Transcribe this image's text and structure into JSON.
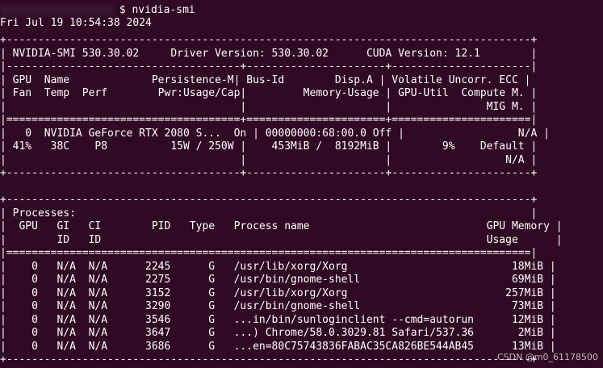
{
  "command": {
    "prompt_symbol": "$",
    "text": "nvidia-smi"
  },
  "timestamp": "Fri Jul 19 10:54:38 2024",
  "header": {
    "smi_label": "NVIDIA-SMI 530.30.02",
    "driver_label": "Driver Version: 530.30.02",
    "cuda_label": "CUDA Version: 12.1"
  },
  "gpu_columns": {
    "line1": "| GPU  Name             Persistence-M| Bus-Id        Disp.A | Volatile Uncorr. ECC |",
    "line2": "| Fan  Temp  Perf        Pwr:Usage/Cap|         Memory-Usage | GPU-Util  Compute M. |",
    "line3": "|                                     |                      |               MIG M. |"
  },
  "gpus": [
    {
      "index": "0",
      "name": "NVIDIA GeForce RTX 2080 S...",
      "persistence": "On",
      "bus_id": "00000000:68:00.0",
      "disp": "Off",
      "ecc": "N/A",
      "fan": "41%",
      "temp": "38C",
      "perf": "P8",
      "power": "15W / 250W",
      "memory_usage": "453MiB /  8192MiB",
      "gpu_util": "9%",
      "compute_mode": "Default",
      "mig_mode": "N/A"
    }
  ],
  "processes": {
    "title": "Processes:",
    "header1": "|  GPU   GI   CI        PID   Type   Process name                            GPU Memory |",
    "header2": "|        ID   ID                                                             Usage      |",
    "rows": [
      {
        "gpu": "0",
        "gi": "N/A",
        "ci": "N/A",
        "pid": "2245",
        "type": "G",
        "name": "/usr/lib/xorg/Xorg",
        "memory": "18MiB"
      },
      {
        "gpu": "0",
        "gi": "N/A",
        "ci": "N/A",
        "pid": "2275",
        "type": "G",
        "name": "/usr/bin/gnome-shell",
        "memory": "69MiB"
      },
      {
        "gpu": "0",
        "gi": "N/A",
        "ci": "N/A",
        "pid": "3152",
        "type": "G",
        "name": "/usr/lib/xorg/Xorg",
        "memory": "257MiB"
      },
      {
        "gpu": "0",
        "gi": "N/A",
        "ci": "N/A",
        "pid": "3290",
        "type": "G",
        "name": "/usr/bin/gnome-shell",
        "memory": "73MiB"
      },
      {
        "gpu": "0",
        "gi": "N/A",
        "ci": "N/A",
        "pid": "3546",
        "type": "G",
        "name": "...in/bin/sunloginclient --cmd=autorun",
        "memory": "12MiB"
      },
      {
        "gpu": "0",
        "gi": "N/A",
        "ci": "N/A",
        "pid": "3647",
        "type": "G",
        "name": "...) Chrome/58.0.3029.81 Safari/537.36",
        "memory": "2MiB"
      },
      {
        "gpu": "0",
        "gi": "N/A",
        "ci": "N/A",
        "pid": "3686",
        "type": "G",
        "name": "...en=80C75743836FABAC35CA826BE544AB45",
        "memory": "13MiB"
      }
    ]
  },
  "watermark": "CSDN @m0_61178500",
  "colors": {
    "background": "#300a24",
    "text": "#ffffff"
  }
}
